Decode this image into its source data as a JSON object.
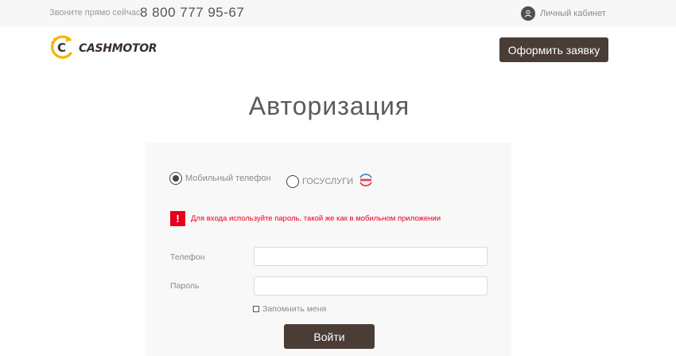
{
  "topbar": {
    "call_label": "Звоните прямо сейчас:",
    "phone": "8 800 777 95-67",
    "cabinet_label": "Личный кабинет",
    "cabinet_icon": "user-icon"
  },
  "header": {
    "logo_text": "CASHMOTOR",
    "logo_icon": "cashmotor-logo-icon",
    "apply_label": "Оформить заявку"
  },
  "page": {
    "title": "Авторизация"
  },
  "auth": {
    "methods": [
      {
        "label": "Мобильный телефон",
        "selected": true
      },
      {
        "label": "ГОСУСЛУГИ",
        "selected": false
      }
    ],
    "alert_icon": "!",
    "alert_text": "Для входа используйте пароль, такой же как в мобильном приложении",
    "phone_label": "Телефон",
    "phone_value": "",
    "password_label": "Пароль",
    "password_value": "",
    "remember_label": "Запомнить меня",
    "login_label": "Войти"
  },
  "colors": {
    "brand_dark": "#4a3d36",
    "accent_yellow": "#f5b400",
    "alert_red": "#e8001b"
  }
}
